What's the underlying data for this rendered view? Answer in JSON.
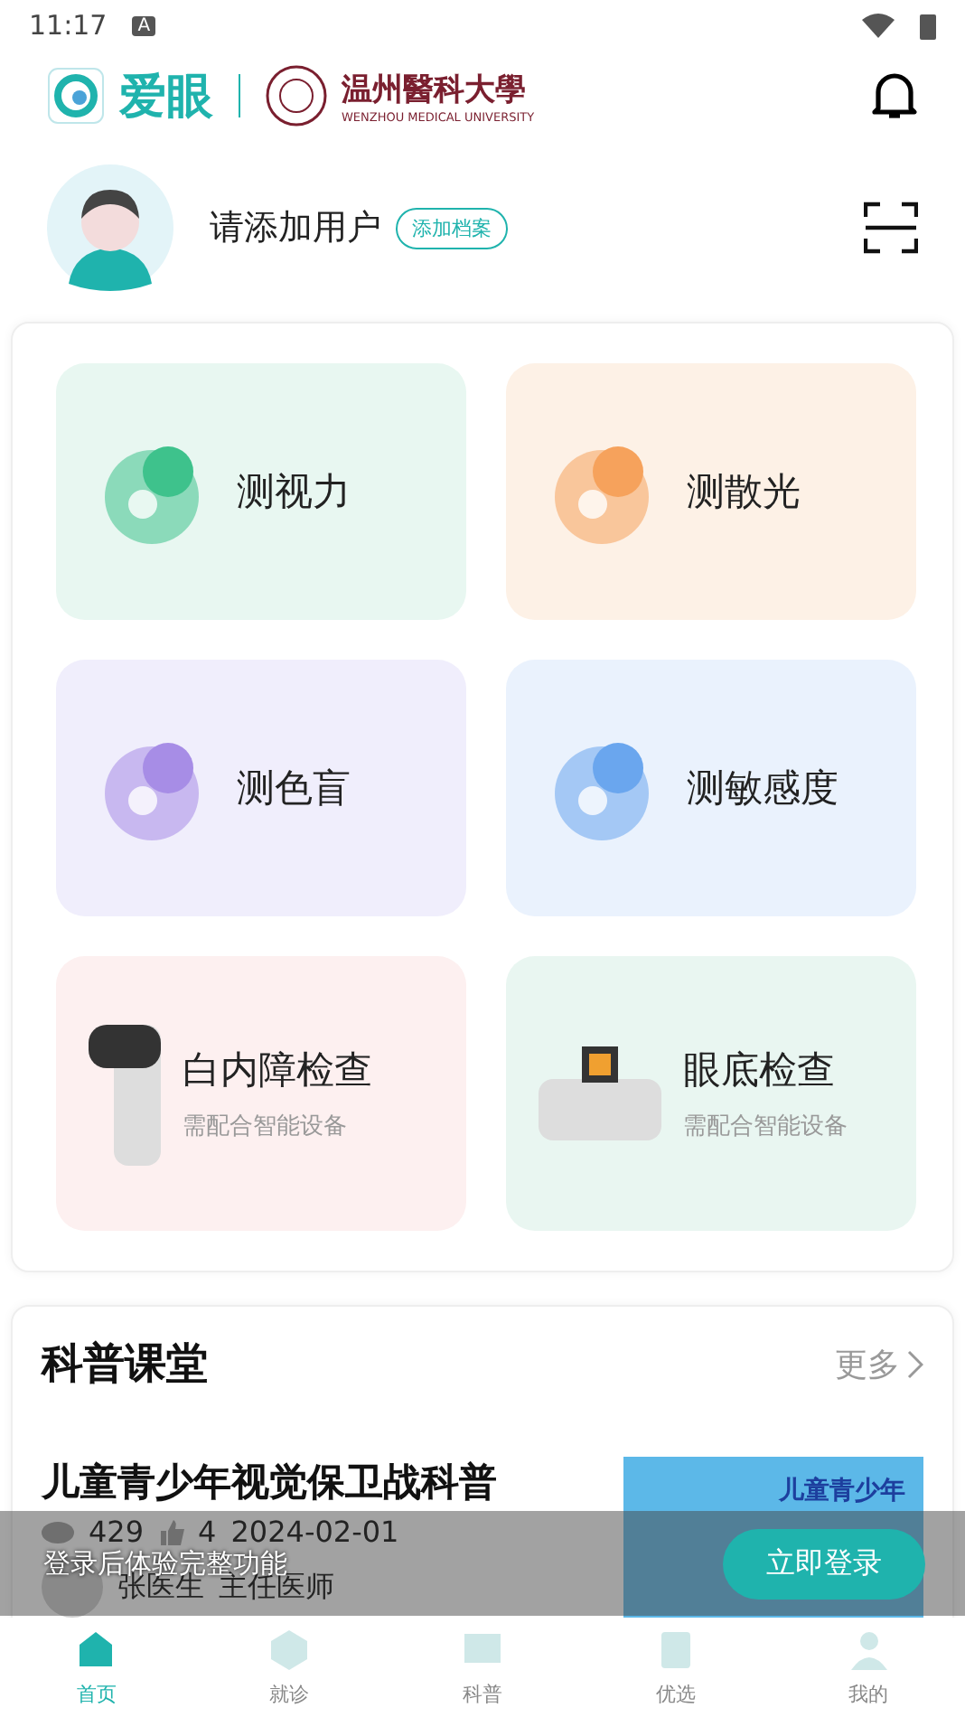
{
  "status_bar": {
    "time": "11:17",
    "indicator": "A"
  },
  "header": {
    "app_name": "爱眼",
    "partner_name": "温州醫科大學",
    "partner_subtitle": "WENZHOU MEDICAL UNIVERSITY"
  },
  "user": {
    "prompt": "请添加用户",
    "add_button": "添加档案"
  },
  "tests": [
    {
      "kind": "test",
      "label": "测视力",
      "color": "#e8f7f1"
    },
    {
      "kind": "test",
      "label": "测散光",
      "color": "#fdf1e6"
    },
    {
      "kind": "test",
      "label": "测色盲",
      "color": "#f0eefc"
    },
    {
      "kind": "test",
      "label": "测敏感度",
      "color": "#eaf2fd"
    },
    {
      "kind": "device",
      "label": "白内障检查",
      "note": "需配合智能设备",
      "color": "#fdf0f0"
    },
    {
      "kind": "device",
      "label": "眼底检查",
      "note": "需配合智能设备",
      "color": "#e9f6f1"
    }
  ],
  "lessons": {
    "title": "科普课堂",
    "more": "更多",
    "articles": [
      {
        "title": "儿童青少年视觉保卫战科普",
        "views": "429",
        "likes": "4",
        "date": "2024-02-01",
        "author": "张医生",
        "role": "主任医师",
        "thumb_text": "儿童青少年"
      }
    ]
  },
  "login_bar": {
    "message": "登录后体验完整功能",
    "button": "立即登录"
  },
  "nav": [
    {
      "label": "首页",
      "selected": true
    },
    {
      "label": "就诊",
      "selected": false
    },
    {
      "label": "科普",
      "selected": false
    },
    {
      "label": "优选",
      "selected": false
    },
    {
      "label": "我的",
      "selected": false
    }
  ]
}
